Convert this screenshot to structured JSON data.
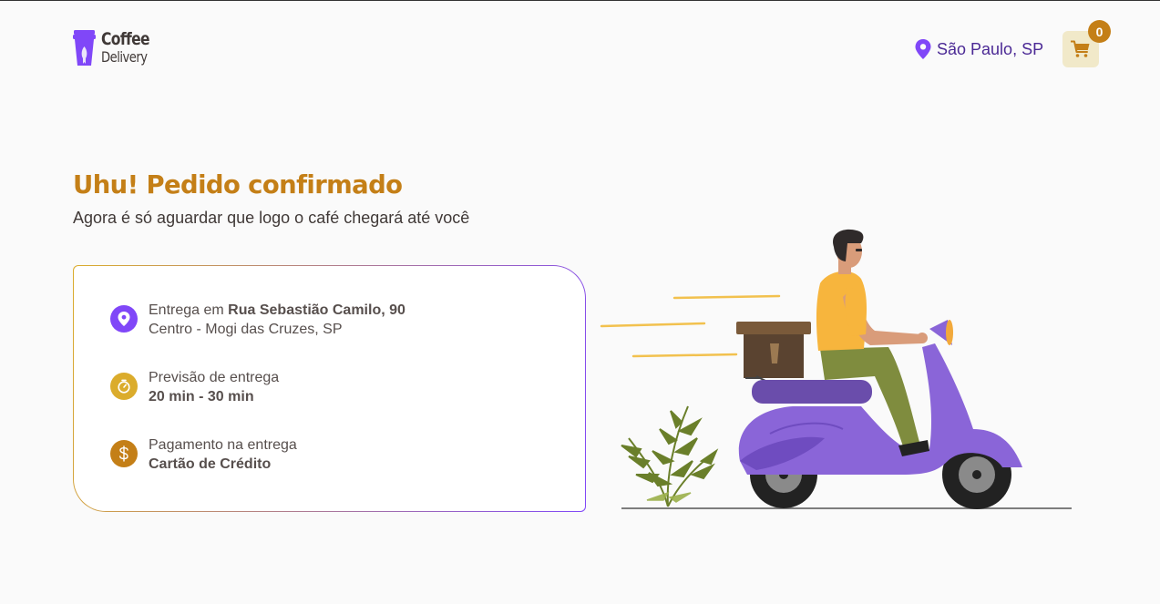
{
  "header": {
    "logo": {
      "word1": "Coffee",
      "word2": "Delivery"
    },
    "location": "São Paulo, SP",
    "cart_count": "0"
  },
  "main": {
    "title": "Uhu! Pedido confirmado",
    "subtitle": "Agora é só aguardar que logo o café chegará até você"
  },
  "order_info": {
    "delivery": {
      "prefix": "Entrega em",
      "address": "Rua Sebastião Camilo, 90",
      "district": "Centro - Mogi das Cruzes, SP"
    },
    "eta": {
      "label": "Previsão de entrega",
      "value": "20 min - 30 min"
    },
    "payment": {
      "label": "Pagamento na entrega",
      "value": "Cartão de Crédito"
    }
  },
  "colors": {
    "brand_purple": "#8047f8",
    "purple_dark": "#4b2995",
    "yellow": "#dbac2c",
    "yellow_dark": "#c47f17",
    "yellow_light": "#f1e9c9"
  },
  "icons": {
    "logo": "coffee-cup-logo-icon",
    "location": "map-pin-icon",
    "cart": "shopping-cart-icon",
    "delivery": "map-pin-icon",
    "eta": "timer-icon",
    "payment": "dollar-icon"
  }
}
